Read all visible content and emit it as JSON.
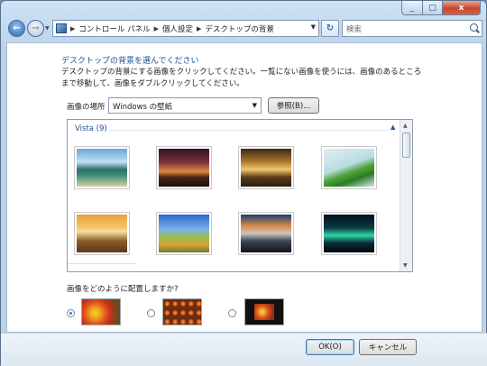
{
  "window": {
    "min_glyph": "_",
    "max_glyph": "□",
    "close_glyph": "x"
  },
  "nav": {
    "breadcrumb": [
      "コントロール パネル",
      "個人設定",
      "デスクトップの背景"
    ],
    "search_placeholder": "検索"
  },
  "main": {
    "heading": "デスクトップの背景を選んでください",
    "description": "デスクトップの背景にする画像をクリックしてください。一覧にない画像を使うには、画像のあるところまで移動して、画像をダブルクリックしてください。",
    "location_label": "画像の場所",
    "location_value": "Windows の壁紙",
    "browse_label": "参照(B)...",
    "group_title": "Vista (9)",
    "thumbnails": [
      "img1",
      "img2",
      "img3",
      "img4",
      "img5",
      "img6",
      "img7",
      "img8"
    ],
    "position_question": "画像をどのように配置しますか?",
    "positions_selected": 0
  },
  "footer": {
    "ok_label": "OK(O)",
    "cancel_label": "キャンセル"
  }
}
